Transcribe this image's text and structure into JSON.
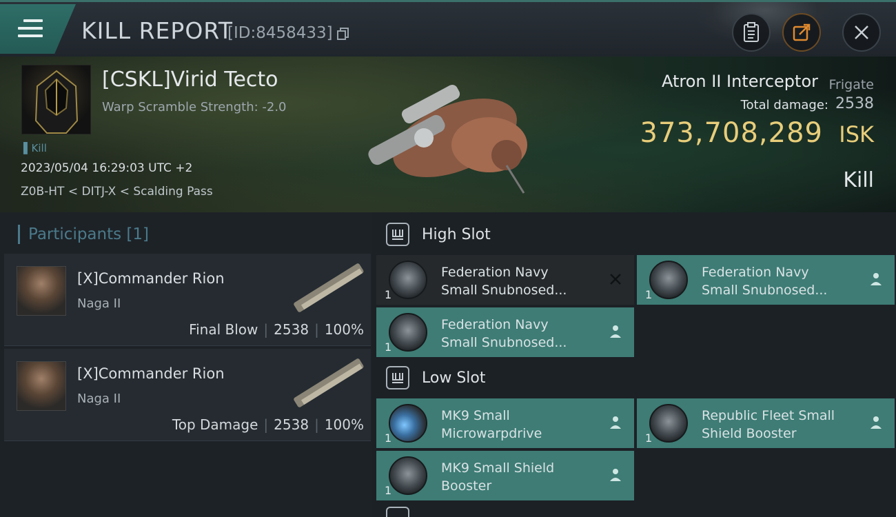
{
  "header": {
    "title": "KILL REPORT",
    "report_id": "[ID:8458433]"
  },
  "victim": {
    "pilot_name": "[CSKL]Virid Tecto",
    "warp_scramble": "Warp Scramble Strength: -2.0",
    "kill_tag": "Kill",
    "datetime": "2023/05/04 16:29:03 UTC +2",
    "location": "Z0B-HT < DITJ-X < Scalding Pass",
    "ship_name": "Atron II Interceptor",
    "ship_class": "Frigate",
    "total_damage_label": "Total damage:",
    "total_damage": "2538",
    "isk_value": "373,708,289",
    "isk_unit": "ISK",
    "kill_type": "Kill"
  },
  "participants": {
    "header": "Participants [1]",
    "rows": [
      {
        "name": "[X]Commander Rion",
        "ship": "Naga II",
        "role": "Final Blow",
        "damage": "2538",
        "percent": "100%"
      },
      {
        "name": "[X]Commander Rion",
        "ship": "Naga II",
        "role": "Top Damage",
        "damage": "2538",
        "percent": "100%"
      }
    ]
  },
  "fitting": {
    "high_slot": {
      "title": "High Slot",
      "modules": [
        {
          "qty": "1",
          "line1": "Federation Navy",
          "line2": "Small Snubnosed...",
          "status": "destroyed"
        },
        {
          "qty": "1",
          "line1": "Federation Navy",
          "line2": "Small Snubnosed...",
          "status": "dropped"
        },
        {
          "qty": "1",
          "line1": "Federation Navy",
          "line2": "Small Snubnosed...",
          "status": "dropped"
        }
      ]
    },
    "low_slot": {
      "title": "Low Slot",
      "modules": [
        {
          "qty": "1",
          "line1": "MK9 Small",
          "line2": "Microwarpdrive",
          "status": "dropped"
        },
        {
          "qty": "1",
          "line1": "Republic Fleet Small",
          "line2": "Shield Booster",
          "status": "dropped"
        },
        {
          "qty": "1",
          "line1": "MK9 Small Shield",
          "line2": "Booster",
          "status": "dropped"
        }
      ]
    }
  },
  "colors": {
    "accent_teal": "#3e7c75",
    "isk_gold": "#e8cd7a",
    "menu_teal": "#2f6e68"
  }
}
